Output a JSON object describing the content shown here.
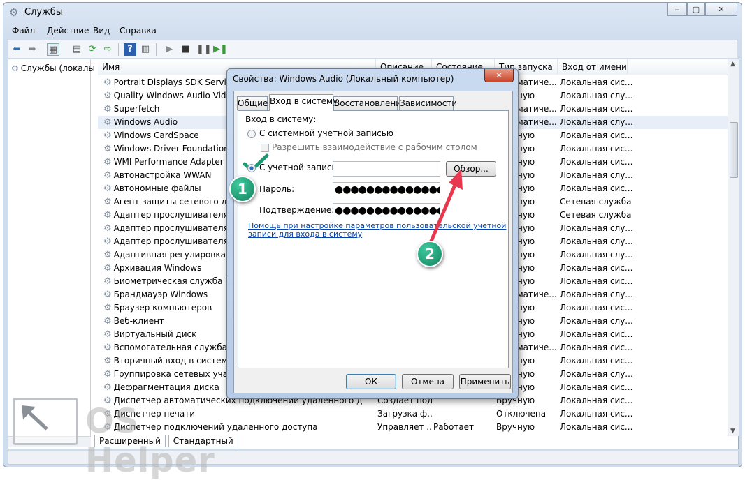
{
  "window": {
    "title": "Службы",
    "min": "‒",
    "max": "▢",
    "close": "✕"
  },
  "menu": [
    "Файл",
    "Действие",
    "Вид",
    "Справка"
  ],
  "tree": {
    "item": "Службы (локалы"
  },
  "columns": [
    "Имя",
    "Описание",
    "Состояние",
    "Тип запуска",
    "Вход от имени"
  ],
  "services": [
    {
      "name": "Portrait Displays SDK Service",
      "desc": "",
      "state": "",
      "startup": "Автоматиче...",
      "logon": "Локальная сис..."
    },
    {
      "name": "Quality Windows Audio Video Experience",
      "desc": "",
      "state": "",
      "startup": "Вручную",
      "logon": "Локальная слу..."
    },
    {
      "name": "Superfetch",
      "desc": "",
      "state": "",
      "startup": "Автоматиче...",
      "logon": "Локальная сис..."
    },
    {
      "name": "Windows Audio",
      "desc": "",
      "state": "",
      "startup": "Автоматиче...",
      "logon": "Локальная слу..."
    },
    {
      "name": "Windows CardSpace",
      "desc": "",
      "state": "",
      "startup": "Вручную",
      "logon": "Локальная сис..."
    },
    {
      "name": "Windows Driver Foundation - U",
      "desc": "",
      "state": "",
      "startup": "Вручную",
      "logon": "Локальная сис..."
    },
    {
      "name": "WMI Performance Adapter",
      "desc": "",
      "state": "",
      "startup": "Вручную",
      "logon": "Локальная сис..."
    },
    {
      "name": "Автонастройка WWAN",
      "desc": "",
      "state": "",
      "startup": "Вручную",
      "logon": "Локальная слу..."
    },
    {
      "name": "Автономные файлы",
      "desc": "",
      "state": "",
      "startup": "Вручную",
      "logon": "Локальная сис..."
    },
    {
      "name": "Агент защиты сетевого досту",
      "desc": "",
      "state": "",
      "startup": "Вручную",
      "logon": "Сетевая служба"
    },
    {
      "name": "Адаптер прослушивателя Net",
      "desc": "",
      "state": "",
      "startup": "Вручную",
      "logon": "Сетевая служба"
    },
    {
      "name": "Адаптер прослушивателя Net",
      "desc": "",
      "state": "",
      "startup": "Вручную",
      "logon": "Локальная слу..."
    },
    {
      "name": "Адаптер прослушивателя Net",
      "desc": "",
      "state": "",
      "startup": "Вручную",
      "logon": "Локальная слу..."
    },
    {
      "name": "Адаптивная регулировка ярко",
      "desc": "",
      "state": "",
      "startup": "Вручную",
      "logon": "Локальная слу..."
    },
    {
      "name": "Архивация Windows",
      "desc": "",
      "state": "",
      "startup": "Вручную",
      "logon": "Локальная сис..."
    },
    {
      "name": "Биометрическая служба Windo",
      "desc": "",
      "state": "",
      "startup": "Вручную",
      "logon": "Локальная сис..."
    },
    {
      "name": "Брандмауэр Windows",
      "desc": "",
      "state": "",
      "startup": "Автоматиче...",
      "logon": "Локальная слу..."
    },
    {
      "name": "Браузер компьютеров",
      "desc": "",
      "state": "",
      "startup": "Вручную",
      "logon": "Локальная сис..."
    },
    {
      "name": "Веб-клиент",
      "desc": "",
      "state": "",
      "startup": "Вручную",
      "logon": "Локальная слу..."
    },
    {
      "name": "Виртуальный диск",
      "desc": "",
      "state": "",
      "startup": "Вручную",
      "logon": "Локальная сис..."
    },
    {
      "name": "Вспомогательная служба IP",
      "desc": "",
      "state": "",
      "startup": "Автоматиче...",
      "logon": "Локальная сис..."
    },
    {
      "name": "Вторичный вход в систему",
      "desc": "",
      "state": "",
      "startup": "Вручную",
      "logon": "Локальная сис..."
    },
    {
      "name": "Группировка сетевых участни",
      "desc": "",
      "state": "",
      "startup": "Вручную",
      "logon": "Локальная слу..."
    },
    {
      "name": "Дефрагментация диска",
      "desc": "",
      "state": "",
      "startup": "Вручную",
      "logon": "Локальная сис..."
    },
    {
      "name": "Диспетчер автоматических подключений удаленного доступа",
      "desc": "Создает под...",
      "state": "",
      "startup": "Вручную",
      "logon": "Локальная сис..."
    },
    {
      "name": "Диспетчер печати",
      "desc": "Загрузка ф...",
      "state": "",
      "startup": "Отключена",
      "logon": "Локальная сис..."
    },
    {
      "name": "Диспетчер подключений удаленного доступа",
      "desc": "Управляет ...",
      "state": "Работает",
      "startup": "Вручную",
      "logon": "Локальная сис..."
    }
  ],
  "bottom_tabs": [
    "Расширенный",
    "Стандартный"
  ],
  "dialog": {
    "title": "Свойства: Windows Audio (Локальный компьютер)",
    "close": "✕",
    "tabs": [
      "Общие",
      "Вход в систему",
      "Восстановление",
      "Зависимости"
    ],
    "section": "Вход в систему:",
    "radio_system": "С системной учетной записью",
    "checkbox_desktop": "Разрешить взаимодействие с рабочим столом",
    "radio_account": "С учетной записью:",
    "account_value": "",
    "password_label": "Пароль:",
    "password_value": "●●●●●●●●●●●●●●●",
    "confirm_label": "Подтверждение:",
    "confirm_value": "●●●●●●●●●●●●●●●",
    "browse": "Обзор...",
    "help_link_line1": "Помощь при настройке параметров пользовательской учетной",
    "help_link_line2": "записи для входа в систему",
    "ok": "ОК",
    "cancel": "Отмена",
    "apply": "Применить"
  },
  "annotations": {
    "badge1": "1",
    "badge2": "2",
    "arrow_color": "#e8384f",
    "badge_color": "#1a9a72"
  },
  "watermark": "OS Helper"
}
